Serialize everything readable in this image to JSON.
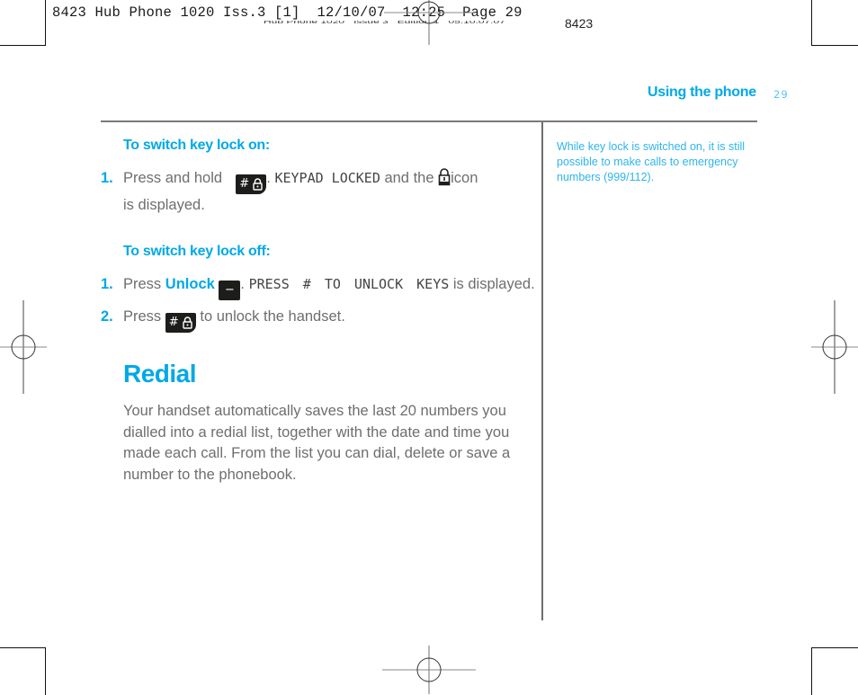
{
  "print_slug": {
    "primary": "8423 Hub Phone 1020 Iss.3 [1]  12/10/07  12:25  Page 29",
    "secondary": "Hub Phone 1020   Issue 3   Edition 1   05.10.07.07",
    "code": "8423"
  },
  "header": {
    "section_title": "Using the phone",
    "page_number": "29"
  },
  "sidebar_note": {
    "text": "While key lock is switched on, it is still possible to make calls to emergency numbers (999/112)."
  },
  "key_lock_on": {
    "heading": "To switch key lock on:",
    "steps": [
      {
        "number": "1.",
        "pre": "Press and hold",
        "key_label": "#",
        "key_icon": "lock-icon",
        "sep": ".",
        "display_text": "KEYPAD LOCKED",
        "mid": "and the",
        "status_icon": "padlock-icon",
        "post": "icon",
        "line2": "is displayed."
      }
    ]
  },
  "key_lock_off": {
    "heading": "To switch key lock off:",
    "steps": [
      {
        "number": "1.",
        "pre": "Press",
        "keyword": "Unlock",
        "key_label": "−",
        "sep": ".",
        "display_text": "PRESS # TO UNLOCK KEYS",
        "post": "is displayed."
      },
      {
        "number": "2.",
        "pre": "Press",
        "key_label": "#",
        "key_icon": "lock-icon",
        "post": "to unlock the handset."
      }
    ]
  },
  "redial": {
    "title": "Redial",
    "body": "Your handset automatically saves the last 20 numbers you dialled into a redial list, together with the date and time you made each call. From the list you can dial, delete or save a number to the phonebook."
  },
  "colors": {
    "accent": "#00a9e6",
    "note": "#2db5ec",
    "body_text": "#6d6e70",
    "rule": "#7a7a7a",
    "key_bg": "#1d1d1b"
  }
}
